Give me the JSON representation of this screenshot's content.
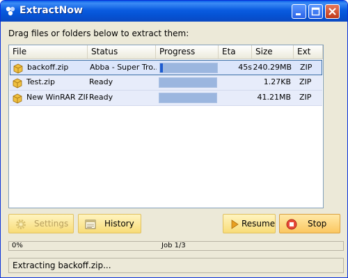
{
  "window": {
    "title": "ExtractNow",
    "minimize_icon": "minimize-icon",
    "maximize_icon": "maximize-icon",
    "close_icon": "close-icon"
  },
  "instruction": "Drag files or folders below to extract them:",
  "list": {
    "columns": [
      "File",
      "Status",
      "Progress",
      "Eta",
      "Size",
      "Ext"
    ],
    "rows": [
      {
        "file": "backoff.zip",
        "status": "Abba - Super Tro..",
        "progress": 0.05,
        "eta": "45s",
        "size": "240.29MB",
        "ext": "ZIP",
        "selected": true,
        "icon": "zip-archive-icon"
      },
      {
        "file": "Test.zip",
        "status": "Ready",
        "progress": 0,
        "eta": "",
        "size": "1.27KB",
        "ext": "ZIP",
        "selected": false,
        "icon": "zip-archive-icon"
      },
      {
        "file": "New WinRAR ZIP ...",
        "status": "Ready",
        "progress": 0,
        "eta": "",
        "size": "41.21MB",
        "ext": "ZIP",
        "selected": false,
        "icon": "zip-archive-icon"
      }
    ]
  },
  "buttons": {
    "settings": "Settings",
    "history": "History",
    "resume": "Resume",
    "stop": "Stop"
  },
  "status": {
    "percent": "0%",
    "job": "Job 1/3",
    "message": "Extracting backoff.zip..."
  },
  "colors": {
    "titlebar": "#0a5be0",
    "progress_fill": "#1d5bd0",
    "button_bg": "#f8dc78"
  }
}
